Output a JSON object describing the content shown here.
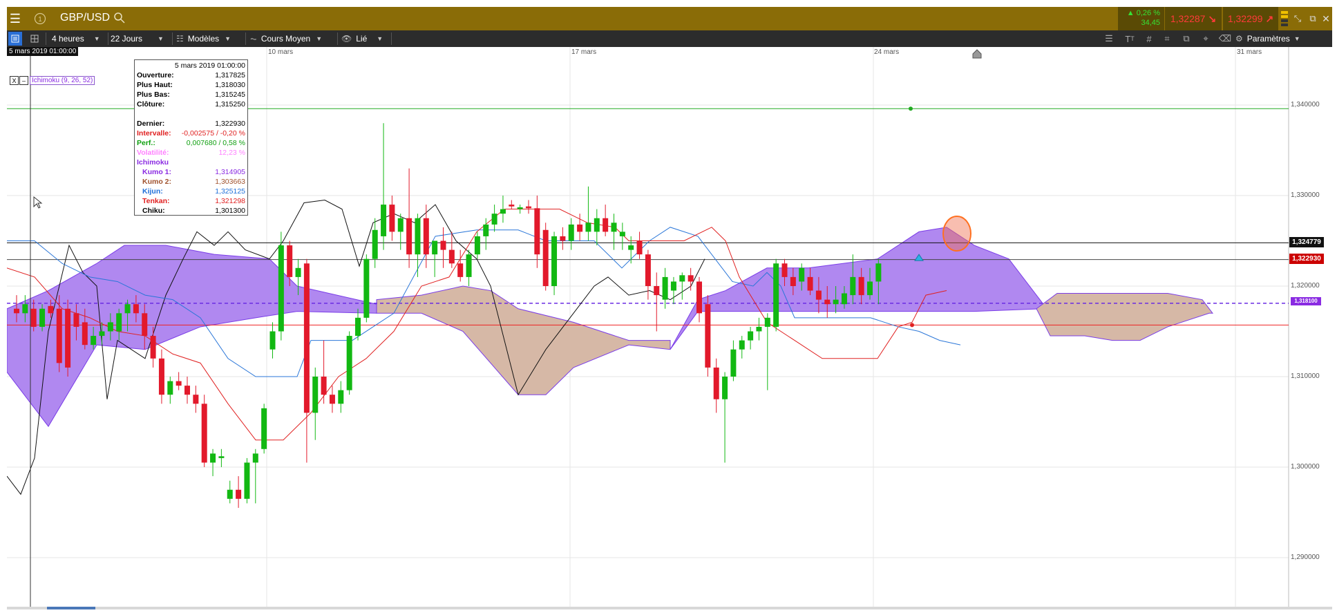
{
  "header": {
    "symbol": "GBP/USD",
    "perf_pct": "▲ 0,26 %",
    "perf_pts": "34,45",
    "sell_price": "1,32287",
    "buy_price": "1,32299"
  },
  "toolbar": {
    "period": "4 heures",
    "range": "22 Jours",
    "templates": "Modèles",
    "chart_type": "Cours Moyen",
    "link": "Lié",
    "settings": "Paramètres"
  },
  "chart": {
    "crosshair_date": "5 mars 2019 01:00:00",
    "date_labels": [
      "10 mars",
      "17 mars",
      "24 mars",
      "31 mars"
    ],
    "price_labels": [
      "1,340000",
      "1,330000",
      "1,320000",
      "1,310000",
      "1,300000",
      "1,290000"
    ],
    "tag_black": "1,324779",
    "tag_red": "1,322930",
    "tag_purple": "1,318100",
    "indicator": "Ichimoku (9, 26, 52)",
    "indicator_close": "X",
    "indicator_min": "–"
  },
  "tooltip": {
    "title": "5 mars 2019 01:00:00",
    "rows": [
      {
        "label": "Ouverture:",
        "value": "1,317825",
        "color": "#000000"
      },
      {
        "label": "Plus Haut:",
        "value": "1,318030",
        "color": "#000000"
      },
      {
        "label": "Plus Bas:",
        "value": "1,315245",
        "color": "#000000"
      },
      {
        "label": "Clôture:",
        "value": "1,315250",
        "color": "#000000"
      }
    ],
    "rows2": [
      {
        "label": "Dernier:",
        "value": "1,322930",
        "color": "#000000"
      },
      {
        "label": "Intervalle:",
        "value": "-0,002575 / -0,20 %",
        "color": "#e02020"
      },
      {
        "label": "Perf.:",
        "value": "0,007680 / 0,58 %",
        "color": "#10a010"
      },
      {
        "label": "Volatilité:",
        "value": "12,23 %",
        "color": "#ff80ff"
      },
      {
        "label": "Ichimoku",
        "value": "",
        "color": "#8a2be2"
      },
      {
        "label": "Kumo 1:",
        "value": "1,314905",
        "color": "#8a2be2"
      },
      {
        "label": "Kumo 2:",
        "value": "1,303663",
        "color": "#a0522d"
      },
      {
        "label": "Kijun:",
        "value": "1,325125",
        "color": "#1e6fd9"
      },
      {
        "label": "Tenkan:",
        "value": "1,321298",
        "color": "#e02020"
      },
      {
        "label": "Chiku:",
        "value": "1,301300",
        "color": "#000000"
      }
    ]
  },
  "chart_data": {
    "type": "candlestick",
    "x_labels": [
      "10 mars",
      "17 mars",
      "24 mars",
      "31 mars"
    ],
    "ylim": [
      1.285,
      1.345
    ],
    "candles": [
      [
        1.3175,
        1.319,
        1.316,
        1.317
      ],
      [
        1.317,
        1.319,
        1.316,
        1.318
      ],
      [
        1.3175,
        1.3185,
        1.315,
        1.3155
      ],
      [
        1.3155,
        1.318,
        1.315,
        1.3175
      ],
      [
        1.3178,
        1.3185,
        1.3165,
        1.317
      ],
      [
        1.3175,
        1.319,
        1.3105,
        1.3115
      ],
      [
        1.3175,
        1.3185,
        1.31,
        1.311
      ],
      [
        1.317,
        1.318,
        1.314,
        1.3155
      ],
      [
        1.316,
        1.3175,
        1.313,
        1.3135
      ],
      [
        1.3135,
        1.3155,
        1.313,
        1.3145
      ],
      [
        1.3145,
        1.316,
        1.3135,
        1.315
      ],
      [
        1.315,
        1.317,
        1.314,
        1.316
      ],
      [
        1.315,
        1.3175,
        1.314,
        1.317
      ],
      [
        1.317,
        1.3185,
        1.315,
        1.318
      ],
      [
        1.318,
        1.319,
        1.316,
        1.317
      ],
      [
        1.317,
        1.318,
        1.313,
        1.3145
      ],
      [
        1.3145,
        1.3155,
        1.311,
        1.312
      ],
      [
        1.312,
        1.313,
        1.307,
        1.308
      ],
      [
        1.308,
        1.31,
        1.307,
        1.3095
      ],
      [
        1.3095,
        1.3105,
        1.3085,
        1.309
      ],
      [
        1.309,
        1.31,
        1.307,
        1.308
      ],
      [
        1.308,
        1.309,
        1.306,
        1.307
      ],
      [
        1.307,
        1.308,
        1.3,
        1.3005
      ],
      [
        1.3005,
        1.302,
        1.299,
        1.3015
      ],
      [
        1.301,
        1.302,
        1.3,
        1.3012
      ],
      [
        1.2965,
        1.2985,
        1.296,
        1.2975
      ],
      [
        1.2975,
        1.299,
        1.2955,
        1.2965
      ],
      [
        1.2965,
        1.301,
        1.296,
        1.3005
      ],
      [
        1.3005,
        1.302,
        1.296,
        1.3015
      ],
      [
        1.302,
        1.307,
        1.3015,
        1.3065
      ],
      [
        1.313,
        1.316,
        1.312,
        1.315
      ],
      [
        1.315,
        1.326,
        1.314,
        1.3245
      ],
      [
        1.3245,
        1.325,
        1.32,
        1.321
      ],
      [
        1.321,
        1.323,
        1.319,
        1.322
      ],
      [
        1.3225,
        1.323,
        1.3005,
        1.306
      ],
      [
        1.306,
        1.311,
        1.303,
        1.31
      ],
      [
        1.31,
        1.314,
        1.307,
        1.308
      ],
      [
        1.308,
        1.309,
        1.306,
        1.307
      ],
      [
        1.307,
        1.3095,
        1.306,
        1.3085
      ],
      [
        1.3085,
        1.315,
        1.308,
        1.3145
      ],
      [
        1.3145,
        1.3175,
        1.314,
        1.3165
      ],
      [
        1.3165,
        1.3235,
        1.316,
        1.323
      ],
      [
        1.323,
        1.3275,
        1.322,
        1.3262
      ],
      [
        1.3255,
        1.338,
        1.324,
        1.329
      ],
      [
        1.329,
        1.33,
        1.325,
        1.326
      ],
      [
        1.326,
        1.328,
        1.324,
        1.3275
      ],
      [
        1.3275,
        1.333,
        1.322,
        1.3235
      ],
      [
        1.3235,
        1.328,
        1.321,
        1.3275
      ],
      [
        1.3275,
        1.329,
        1.322,
        1.3235
      ],
      [
        1.3235,
        1.325,
        1.321,
        1.325
      ],
      [
        1.325,
        1.3265,
        1.322,
        1.324
      ],
      [
        1.324,
        1.326,
        1.322,
        1.3225
      ],
      [
        1.3225,
        1.324,
        1.3205,
        1.321
      ],
      [
        1.321,
        1.324,
        1.32,
        1.3235
      ],
      [
        1.3235,
        1.326,
        1.323,
        1.3255
      ],
      [
        1.3255,
        1.3275,
        1.324,
        1.3268
      ],
      [
        1.3268,
        1.329,
        1.326,
        1.328
      ],
      [
        1.328,
        1.33,
        1.327,
        1.3285
      ],
      [
        1.329,
        1.3295,
        1.3285,
        1.3288
      ],
      [
        1.3285,
        1.329,
        1.328,
        1.3287
      ],
      [
        1.3288,
        1.3295,
        1.328,
        1.3286
      ],
      [
        1.3286,
        1.33,
        1.322,
        1.3235
      ],
      [
        1.3262,
        1.327,
        1.3195,
        1.32
      ],
      [
        1.32,
        1.326,
        1.319,
        1.3255
      ],
      [
        1.3255,
        1.3265,
        1.324,
        1.325
      ],
      [
        1.325,
        1.3275,
        1.324,
        1.3268
      ],
      [
        1.3268,
        1.328,
        1.325,
        1.326
      ],
      [
        1.326,
        1.331,
        1.325,
        1.327
      ],
      [
        1.326,
        1.3285,
        1.3245,
        1.3275
      ],
      [
        1.3275,
        1.329,
        1.3255,
        1.326
      ],
      [
        1.326,
        1.328,
        1.324,
        1.327
      ],
      [
        1.3255,
        1.327,
        1.324,
        1.326
      ],
      [
        1.324,
        1.3255,
        1.3225,
        1.3245
      ],
      [
        1.325,
        1.326,
        1.323,
        1.3235
      ],
      [
        1.3235,
        1.324,
        1.3185,
        1.32
      ],
      [
        1.32,
        1.3215,
        1.315,
        1.319
      ],
      [
        1.3185,
        1.322,
        1.3175,
        1.321
      ],
      [
        1.3195,
        1.321,
        1.318,
        1.3205
      ],
      [
        1.3205,
        1.3215,
        1.3185,
        1.3212
      ],
      [
        1.3212,
        1.322,
        1.3195,
        1.3205
      ],
      [
        1.3205,
        1.321,
        1.316,
        1.317
      ],
      [
        1.318,
        1.319,
        1.31,
        1.311
      ],
      [
        1.311,
        1.312,
        1.306,
        1.3075
      ],
      [
        1.3075,
        1.3105,
        1.3005,
        1.31
      ],
      [
        1.31,
        1.314,
        1.3095,
        1.313
      ],
      [
        1.313,
        1.3145,
        1.312,
        1.314
      ],
      [
        1.314,
        1.3155,
        1.313,
        1.315
      ],
      [
        1.315,
        1.3165,
        1.314,
        1.3155
      ],
      [
        1.3155,
        1.317,
        1.3085,
        1.3165
      ],
      [
        1.3155,
        1.323,
        1.315,
        1.3225
      ],
      [
        1.3225,
        1.323,
        1.32,
        1.321
      ],
      [
        1.321,
        1.322,
        1.319,
        1.32
      ],
      [
        1.3205,
        1.3225,
        1.3195,
        1.322
      ],
      [
        1.321,
        1.322,
        1.319,
        1.3195
      ],
      [
        1.3195,
        1.321,
        1.317,
        1.3185
      ],
      [
        1.3185,
        1.32,
        1.3165,
        1.318
      ],
      [
        1.318,
        1.32,
        1.317,
        1.3185
      ],
      [
        1.318,
        1.32,
        1.3175,
        1.3192
      ],
      [
        1.319,
        1.3235,
        1.318,
        1.321
      ],
      [
        1.321,
        1.322,
        1.318,
        1.319
      ],
      [
        1.319,
        1.322,
        1.3185,
        1.3205
      ],
      [
        1.3205,
        1.323,
        1.318,
        1.3225
      ]
    ]
  }
}
